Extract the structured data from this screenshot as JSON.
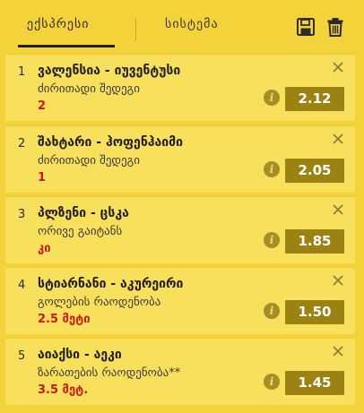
{
  "tabs": {
    "express": "ექსპრესი",
    "system": "სისტემა"
  },
  "icons": {
    "save": "floppy-disk-icon",
    "trash": "trash-icon"
  },
  "colors": {
    "panel": "#f4d23a",
    "card": "#f8df5c",
    "odd_bg": "#9b8213",
    "pick_text": "#c8191b"
  },
  "bets": [
    {
      "num": "1",
      "match": "ვალენსია - იუვენტუსი",
      "market": "ძირითადი შედეგი",
      "pick": "2",
      "odd": "2.12"
    },
    {
      "num": "2",
      "match": "შახტარი - ჰოფენჰაიმი",
      "market": "ძირითადი შედეგი",
      "pick": "1",
      "odd": "2.05"
    },
    {
      "num": "3",
      "match": "პლზენი - ცსკა",
      "market": "ორივე გაიტანს",
      "pick": "კი",
      "odd": "1.85"
    },
    {
      "num": "4",
      "match": "სტიარნანი - აკურეირი",
      "market": "გოლების რაოდენობა",
      "pick": "2.5 მეტი",
      "odd": "1.50"
    },
    {
      "num": "5",
      "match": "აიაქსი - აეკი",
      "market": "ზარათების რაოდენობა**",
      "pick": "3.5 მეტ.",
      "odd": "1.45"
    }
  ]
}
